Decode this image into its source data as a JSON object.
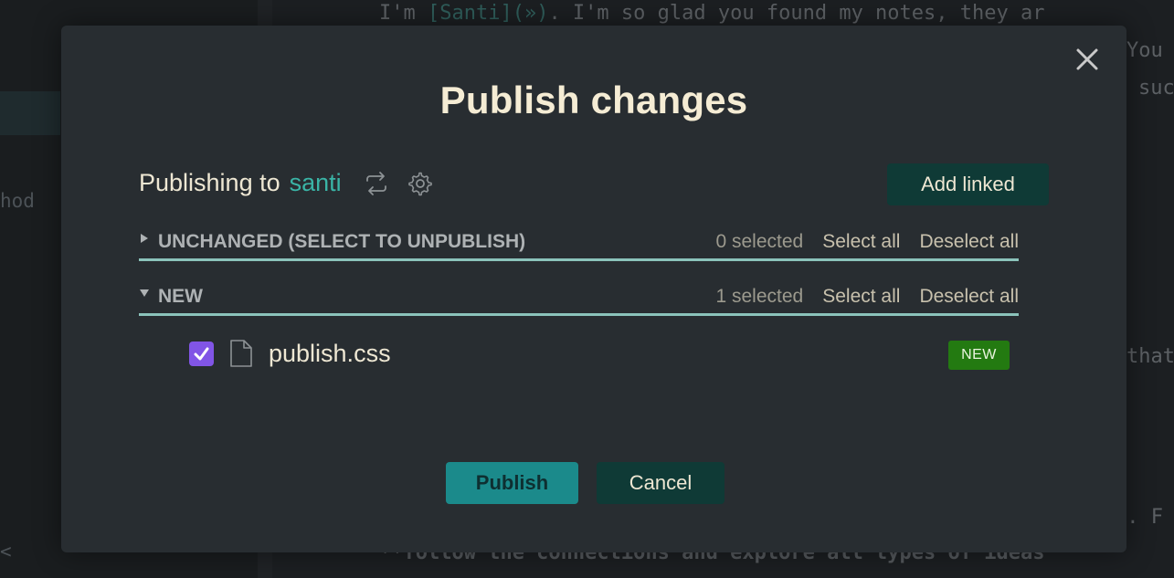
{
  "background": {
    "sidebar_text_1": "hod",
    "sidebar_text_2": "<",
    "editor_lines": [
      {
        "pre": "I'm ",
        "link": "[Santi](»)",
        "post": ". I'm so glad you found my notes, they ar"
      },
      {
        "pre": "",
        "link": "",
        "post": "You"
      },
      {
        "pre": "",
        "link": "",
        "post": "suc"
      },
      {
        "pre": "",
        "link": "",
        "post": "that"
      },
      {
        "pre": "",
        "link": "",
        "post": "s. F"
      },
      {
        "pre": "",
        "link": "",
        "post": "**follow the connections and explore all types of ideas"
      }
    ]
  },
  "modal": {
    "title": "Publish changes",
    "close_icon": "close-icon",
    "publishing_label": "Publishing to",
    "site_name": "santi",
    "switch_icon": "swap-icon",
    "settings_icon": "gear-icon",
    "add_linked_label": "Add linked",
    "sections": [
      {
        "title": "UNCHANGED (SELECT TO UNPUBLISH)",
        "expanded": false,
        "count": "0 selected",
        "select_all": "Select all",
        "deselect_all": "Deselect all"
      },
      {
        "title": "NEW",
        "expanded": true,
        "count": "1 selected",
        "select_all": "Select all",
        "deselect_all": "Deselect all"
      }
    ],
    "files": [
      {
        "name": "publish.css",
        "checked": true,
        "badge": "NEW"
      }
    ],
    "publish_label": "Publish",
    "cancel_label": "Cancel"
  },
  "colors": {
    "accent": "#3ab4a6",
    "checkbox": "#8155e6",
    "badge_new": "#237a11",
    "primary_button": "#1b8a8b",
    "secondary_button": "#0f3a36"
  }
}
